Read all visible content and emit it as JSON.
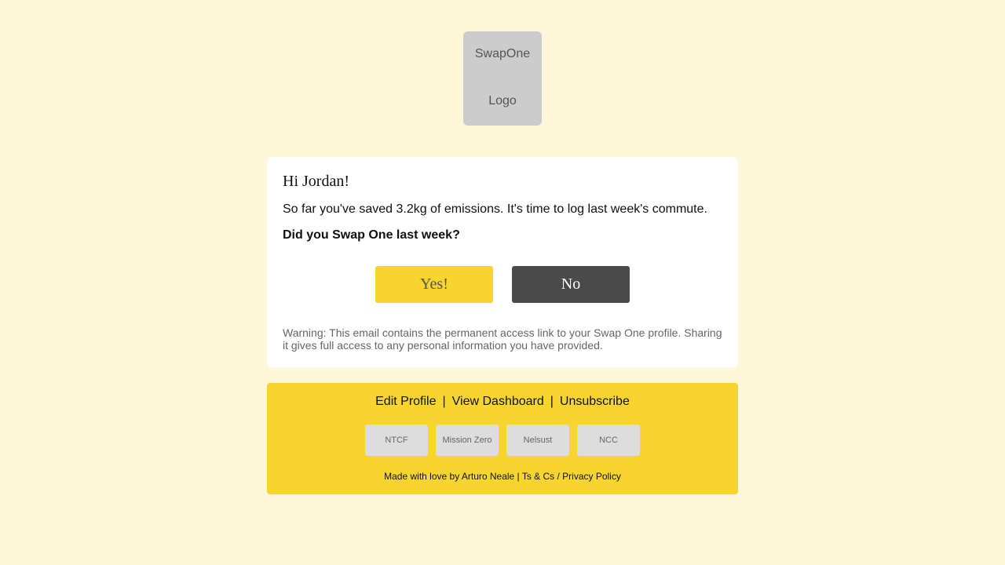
{
  "logo": {
    "line1": "SwapOne",
    "line2": "Logo"
  },
  "email": {
    "greeting": "Hi Jordan!",
    "intro": "So far you've saved 3.2kg of emissions. It's time to log last week's commute.",
    "question": "Did you Swap One last week?",
    "yes_label": "Yes!",
    "no_label": "No",
    "warning": "Warning: This email contains the permanent access link to your Swap One profile. Sharing it gives full access to any personal information you have provided."
  },
  "footer": {
    "links": [
      "Edit Profile",
      "View Dashboard",
      "Unsubscribe"
    ],
    "separator": "|",
    "partners": [
      "NTCF",
      "Mission Zero",
      "Nelsust",
      "NCC"
    ],
    "credit": "Made with love by Arturo Neale |",
    "legal_link": "Ts & Cs / Privacy Policy"
  },
  "colors": {
    "page_background": "#fef6d8",
    "accent_yellow": "#f8d42e",
    "no_button": "#4a4a4a",
    "placeholder_gray": "#cccccc"
  }
}
